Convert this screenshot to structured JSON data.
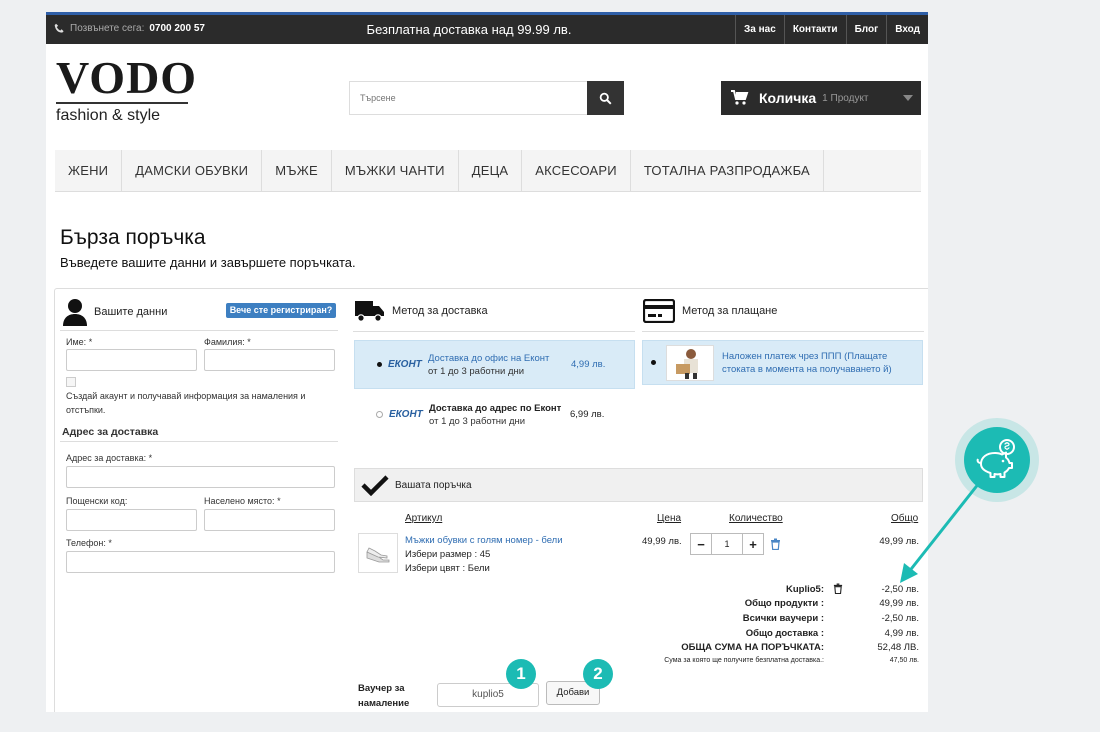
{
  "topbar": {
    "phone_label": "Позвънете сега:",
    "phone_number": "0700 200 57",
    "promo": "Безплатна доставка над 99.99 лв.",
    "links": [
      "За нас",
      "Контакти",
      "Блог",
      "Вход"
    ]
  },
  "logo": {
    "brand": "VODO",
    "tagline": "fashion & style"
  },
  "search": {
    "placeholder": "Търсене"
  },
  "cart": {
    "title": "Количка",
    "count": "1 Продукт"
  },
  "nav": [
    "ЖЕНИ",
    "ДАМСКИ ОБУВКИ",
    "МЪЖЕ",
    "МЪЖКИ ЧАНТИ",
    "ДЕЦА",
    "АКСЕСОАРИ",
    "ТОТАЛНА РАЗПРОДАЖБА"
  ],
  "page": {
    "title": "Бърза поръчка",
    "subtitle": "Въведете вашите данни и завършете поръчката."
  },
  "personal": {
    "heading": "Вашите данни",
    "registered_btn": "Вече сте регистриран?",
    "first_name": "Име:",
    "last_name": "Фамилия:",
    "required": "*",
    "account_text": "Създай акаунт и получавай информация за намаления и отстъпки.",
    "address_heading": "Адрес за доставка",
    "address": "Адрес за доставка:",
    "postcode": "Пощенски код:",
    "city": "Населено място:",
    "phone": "Телефон:"
  },
  "delivery": {
    "heading": "Метод за доставка",
    "options": [
      {
        "carrier": "ЕКОНТ",
        "name": "Доставка до офис на Еконт",
        "eta": "от 1 до 3 работни дни",
        "price": "4,99 лв.",
        "selected": true
      },
      {
        "carrier": "ЕКОНТ",
        "name": "Доставка до адрес по Еконт",
        "eta": "от 1 до 3 работни дни",
        "price": "6,99 лв.",
        "selected": false
      }
    ]
  },
  "payment": {
    "heading": "Метод за плащане",
    "option": "Наложен платеж чрез ППП (Плащате стоката в момента на получаването й)"
  },
  "order": {
    "heading": "Вашата поръчка",
    "columns": {
      "item": "Артикул",
      "price": "Цена",
      "qty": "Количество",
      "total": "Общо"
    },
    "item": {
      "name": "Мъжки обувки с голям номер - бели",
      "size": "Избери размер : 45",
      "color": "Избери цвят : Бели",
      "price": "49,99 лв.",
      "qty": "1",
      "total": "49,99 лв."
    },
    "summary": [
      {
        "label": "Kuplio5:",
        "value": "-2,50 лв."
      },
      {
        "label": "Общо продукти :",
        "value": "49,99 лв."
      },
      {
        "label": "Всички ваучери :",
        "value": "-2,50 лв."
      },
      {
        "label": "Общо доставка :",
        "value": "4,99 лв."
      },
      {
        "label": "ОБЩА СУМА НА ПОРЪЧКАТА:",
        "value": "52,48 ЛВ."
      },
      {
        "label": "Сума за която ще получите безплатна доставка.:",
        "value": "47,50 лв."
      }
    ]
  },
  "voucher": {
    "label_1": "Ваучер за",
    "label_2": "намаление",
    "value": "kuplio5",
    "add": "Добави"
  },
  "markers": [
    "1",
    "2"
  ],
  "colors": {
    "accent": "#1cbbb4",
    "link": "#2f6db2",
    "dark": "#2b2b2b"
  }
}
